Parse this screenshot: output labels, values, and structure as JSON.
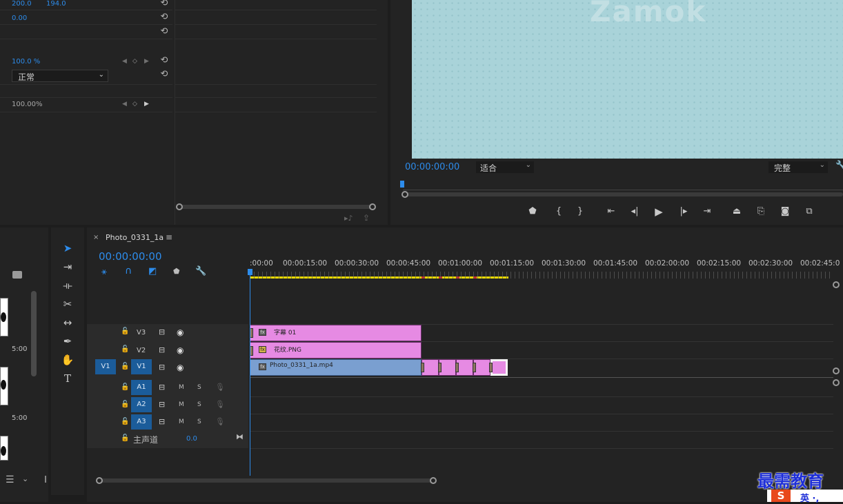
{
  "effect_controls": {
    "position_x": "200.0",
    "position_y": "194.0",
    "rotation": "0.00",
    "opacity": "100.0 %",
    "blend_mode": "正常",
    "time_remap": "100.00%"
  },
  "program_monitor": {
    "watermark": "Zamok",
    "timecode": "00:00:00:00",
    "fit_select": "适合",
    "quality_select": "完整"
  },
  "project_panel": {
    "durations": [
      "5:00",
      "5:00"
    ]
  },
  "timeline": {
    "tab_title": "Photo_0331_1a",
    "timecode": "00:00:00:00",
    "ruler_labels": [
      ":00:00",
      "00:00:15:00",
      "00:00:30:00",
      "00:00:45:00",
      "00:01:00:00",
      "00:01:15:00",
      "00:01:30:00",
      "00:01:45:00",
      "00:02:00:00",
      "00:02:15:00",
      "00:02:30:00",
      "00:02:45:0"
    ],
    "video_tracks": [
      "V3",
      "V2",
      "V1"
    ],
    "source_patch": "V1",
    "audio_tracks": [
      "A1",
      "A2",
      "A3"
    ],
    "mute_label": "M",
    "solo_label": "S",
    "master_label": "主声道",
    "master_value": "0.0",
    "clips": {
      "v3": "字幕 01",
      "v2": "花纹.PNG",
      "v1": "Photo_0331_1a.mp4"
    },
    "fx_badge": "fx"
  },
  "watermark": {
    "brand": "最需教育",
    "ime_text": "英 ·,"
  },
  "colors": {
    "accent_blue": "#2d8ceb",
    "clip_pink": "#e68ae3",
    "clip_blue": "#7a9fd0",
    "monitor_bg": "#a9d3d9"
  }
}
